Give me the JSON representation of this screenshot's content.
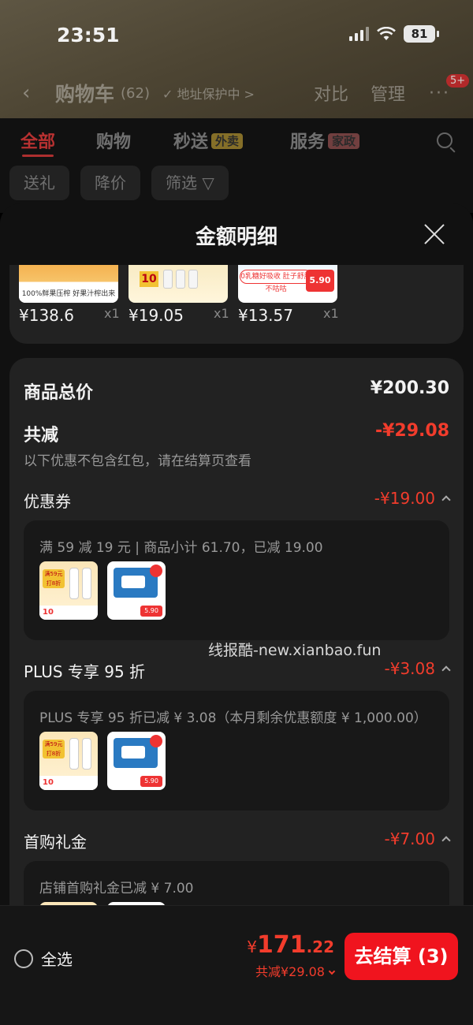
{
  "status_bar": {
    "time": "23:51",
    "battery": "81"
  },
  "cart_header": {
    "back_icon": "chevron-left-icon",
    "title": "购物车",
    "count": "(62)",
    "address_hint": "✓ 地址保护中 >",
    "compare_label": "对比",
    "manage_label": "管理",
    "more_icon": "more-dots-icon",
    "badge": "5+"
  },
  "tabs": [
    {
      "label": "全部"
    },
    {
      "label": "购物"
    },
    {
      "label": "秒送",
      "tag": "外卖"
    },
    {
      "label": "服务",
      "tag": "家政"
    }
  ],
  "filter_chips": [
    "送礼",
    "降价",
    "筛选"
  ],
  "sheet": {
    "title": "金额明细",
    "products": [
      {
        "price": "¥138.6",
        "qty": "x1",
        "thumb_text": "100%鲜果压榨 好果汁榨出来"
      },
      {
        "price": "¥19.05",
        "qty": "x1",
        "thumb_text": "10"
      },
      {
        "price": "¥13.57",
        "qty": "x1",
        "thumb_text": "0乳糖好吸收 肚子舒服不咕咕",
        "thumb_price": "5.90"
      }
    ],
    "total_label": "商品总价",
    "total_value": "¥200.30",
    "discount_label": "共减",
    "discount_value": "-¥29.08",
    "discount_hint": "以下优惠不包含红包，请在结算页查看",
    "sections": [
      {
        "label": "优惠券",
        "amount": "-¥19.00",
        "detail": "满 59 减 19 元 | 商品小计 61.70，已减 19.00"
      },
      {
        "label": "PLUS 专享 95 折",
        "amount": "-¥3.08",
        "detail": "PLUS 专享 95 折已减 ¥ 3.08（本月剩余优惠额度 ¥ 1,000.00）"
      },
      {
        "label": "首购礼金",
        "amount": "-¥7.00",
        "detail": "店铺首购礼金已减 ¥ 7.00"
      }
    ],
    "thumb_a_text": "满59元打8折",
    "thumb_a_foot": "10",
    "thumb_b_price": "5.90"
  },
  "watermark": "线报酷-new.xianbao.fun",
  "bottom": {
    "select_all": "全选",
    "price_symbol": "¥",
    "price_int": "171",
    "price_dec": ".22",
    "saved": "共减¥29.08",
    "checkout": "去结算 (3)"
  },
  "colors": {
    "accent_red": "#f23c2c",
    "checkout_bg": "#f0141e",
    "sheet_bg": "#111111",
    "card_bg": "#222222"
  }
}
